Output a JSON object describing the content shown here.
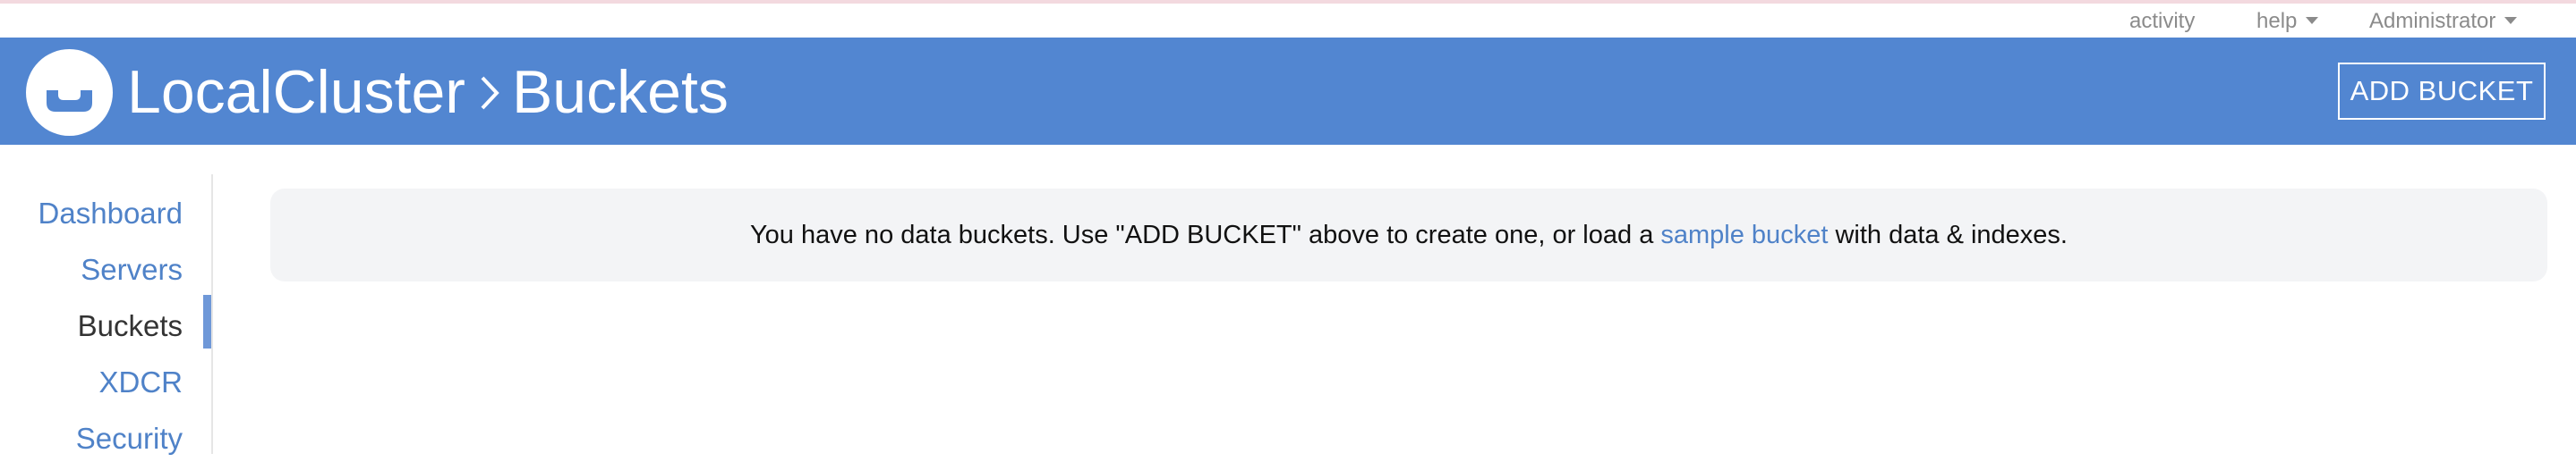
{
  "userbar": {
    "activity": "activity",
    "help": "help",
    "user": "Administrator"
  },
  "header": {
    "cluster": "LocalCluster",
    "page": "Buckets",
    "add_bucket_label": "ADD BUCKET"
  },
  "sidebar": {
    "items": [
      {
        "label": "Dashboard"
      },
      {
        "label": "Servers"
      },
      {
        "label": "Buckets"
      },
      {
        "label": "XDCR"
      },
      {
        "label": "Security"
      }
    ],
    "active": "Buckets"
  },
  "main": {
    "empty_before": "You have no data buckets. Use \"ADD BUCKET\" above to create one, or load a ",
    "empty_link": "sample bucket",
    "empty_after": " with data & indexes."
  },
  "colors": {
    "header_bg": "#5286d1",
    "link": "#4f82c8",
    "active_indicator": "#6f98d8"
  },
  "icons": {
    "logo": "couchbase-logo-icon",
    "separator": "chevron-right-icon",
    "dropdown": "caret-down-icon"
  }
}
